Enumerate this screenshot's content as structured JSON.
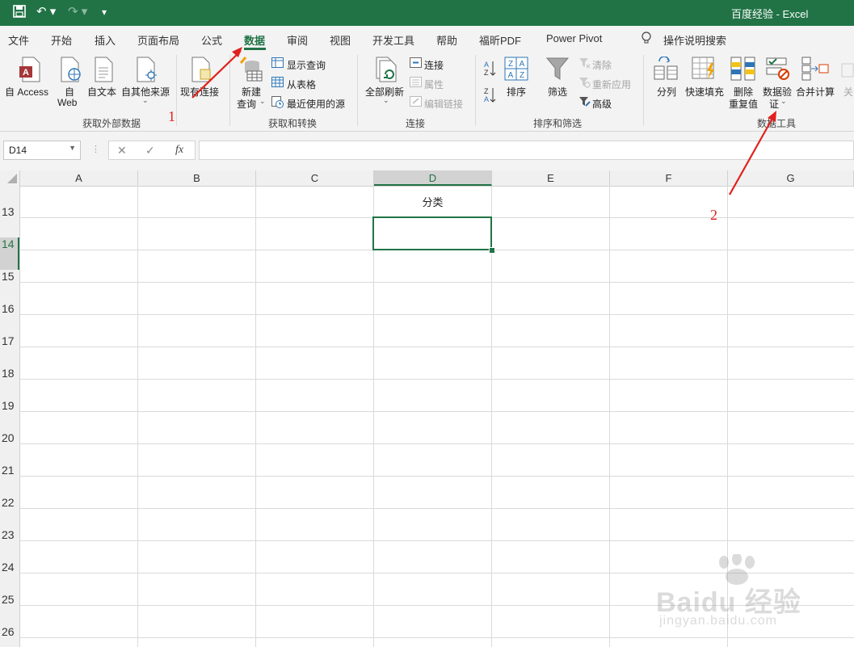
{
  "titlebar": {
    "title": "百度经验  -  Excel",
    "bg": "#217346"
  },
  "tabs": [
    "文件",
    "开始",
    "插入",
    "页面布局",
    "公式",
    "数据",
    "审阅",
    "视图",
    "开发工具",
    "帮助",
    "福昕PDF",
    "Power Pivot"
  ],
  "active_tab": "数据",
  "tell_me": "操作说明搜索",
  "ribbon": {
    "get_external": {
      "access": "自 Access",
      "web1": "自",
      "web2": "Web",
      "text": "自文本",
      "other": "自其他来源",
      "existing": "现有连接",
      "group": "获取外部数据"
    },
    "transform": {
      "new_query1": "新建",
      "new_query2": "查询",
      "show_queries": "显示查询",
      "from_table": "从表格",
      "recent_sources": "最近使用的源",
      "group": "获取和转换"
    },
    "connections": {
      "refresh_all": "全部刷新",
      "connections": "连接",
      "properties": "属性",
      "edit_links": "编辑链接",
      "group": "连接"
    },
    "sort_filter": {
      "sort": "排序",
      "filter": "筛选",
      "clear": "清除",
      "reapply": "重新应用",
      "advanced": "高级",
      "group": "排序和筛选"
    },
    "data_tools": {
      "text_to_columns": "分列",
      "flash_fill": "快速填充",
      "remove_dup1": "删除",
      "remove_dup2": "重复值",
      "validation1": "数据验",
      "validation2": "证",
      "consolidate": "合并计算",
      "cut": "关",
      "group": "数据工具"
    }
  },
  "formula_bar": {
    "name_box": "D14",
    "cancel": "✕",
    "enter": "✓",
    "fx": "fx",
    "value": ""
  },
  "columns": [
    "A",
    "B",
    "C",
    "D",
    "E",
    "F",
    "G"
  ],
  "selected_column": "D",
  "rows": [
    "13",
    "14",
    "15",
    "16",
    "17",
    "18",
    "19",
    "20",
    "21",
    "22",
    "23",
    "24",
    "25",
    "26"
  ],
  "cells": {
    "D13": "分类"
  },
  "active_cell": "D14",
  "annotations": {
    "one": "1",
    "two": "2"
  },
  "watermark": {
    "brand": "Baidu 经验",
    "url": "jingyan.baidu.com"
  },
  "accent": "#217346",
  "arrow_color": "#e0201c"
}
